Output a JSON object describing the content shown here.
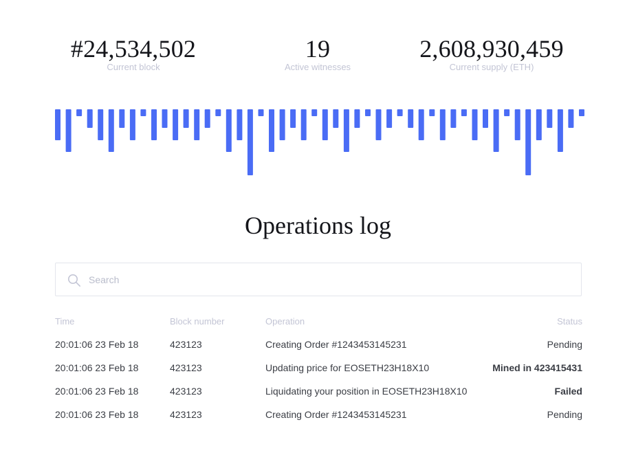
{
  "stats": {
    "current_block": {
      "value": "#24,534,502",
      "label": "Current block"
    },
    "active_witnesses": {
      "value": "19",
      "label": "Active witnesses"
    },
    "current_supply": {
      "value": "2,608,930,459",
      "label": "Current supply (ETH)"
    }
  },
  "activity_bars": {
    "color": "#4a6cf5",
    "levels": [
      3,
      4,
      1,
      2,
      3,
      4,
      2,
      3,
      1,
      3,
      2,
      3,
      2,
      3,
      2,
      1,
      4,
      3,
      5,
      1,
      4,
      3,
      2,
      3,
      1,
      3,
      2,
      4,
      2,
      1,
      3,
      2,
      1,
      2,
      3,
      1,
      3,
      2,
      1,
      3,
      2,
      4,
      1,
      3,
      5,
      3,
      2,
      4,
      2,
      1
    ]
  },
  "log": {
    "title": "Operations log",
    "search": {
      "placeholder": "Search",
      "value": ""
    },
    "columns": {
      "time": "Time",
      "block": "Block number",
      "operation": "Operation",
      "status": "Status"
    },
    "rows": [
      {
        "time": "20:01:06 23 Feb 18",
        "block": "423123",
        "operation": "Creating Order #1243453145231",
        "status": "Pending"
      },
      {
        "time": "20:01:06 23 Feb 18",
        "block": "423123",
        "operation": "Updating price for EOSETH23H18X10",
        "status": "Mined in 423415431"
      },
      {
        "time": "20:01:06 23 Feb 18",
        "block": "423123",
        "operation": "Liquidating your position in EOSETH23H18X10",
        "status": "Failed"
      },
      {
        "time": "20:01:06 23 Feb 18",
        "block": "423123",
        "operation": "Creating Order #1243453145231",
        "status": "Pending"
      }
    ],
    "status_colors": {
      "pending": "#3a3d44",
      "mined": "#1fc08d",
      "failed": "#f05a2a"
    }
  }
}
